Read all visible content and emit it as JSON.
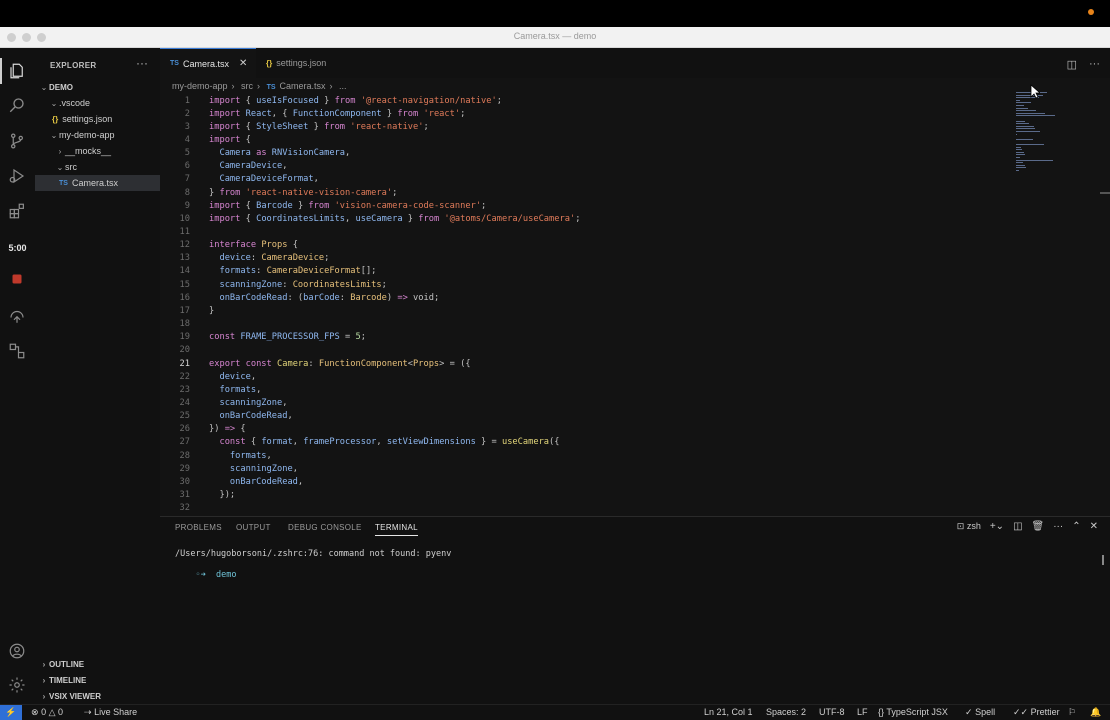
{
  "window": {
    "title": "Camera.tsx — demo"
  },
  "activity_bar": {
    "icons": [
      "files-icon",
      "search-icon",
      "source-control-icon",
      "run-debug-icon",
      "extensions-icon",
      "record-icon",
      "remote-icon",
      "project-manager-icon",
      "account-icon",
      "settings-gear-icon"
    ],
    "timer": "5:00"
  },
  "explorer": {
    "title": "EXPLORER",
    "tree": [
      {
        "label": "DEMO",
        "kind": "root"
      },
      {
        "label": ".vscode",
        "kind": "folder-open"
      },
      {
        "label": "settings.json",
        "kind": "json"
      },
      {
        "label": "my-demo-app",
        "kind": "folder-open"
      },
      {
        "label": "__mocks__",
        "kind": "folder-closed"
      },
      {
        "label": "src",
        "kind": "folder-open"
      },
      {
        "label": "Camera.tsx",
        "kind": "ts",
        "selected": true
      }
    ],
    "sections": [
      "OUTLINE",
      "TIMELINE",
      "VSIX VIEWER"
    ]
  },
  "tabs": [
    {
      "label": "Camera.tsx",
      "icon": "TS",
      "active": true
    },
    {
      "label": "settings.json",
      "icon": "{}",
      "active": false
    }
  ],
  "breadcrumb": [
    "my-demo-app",
    "src",
    "Camera.tsx",
    "..."
  ],
  "code": {
    "current_line": 21,
    "lines": [
      [
        [
          "k",
          "import "
        ],
        [
          "p",
          "{ "
        ],
        [
          "v",
          "useIsFocused"
        ],
        [
          "p",
          " } "
        ],
        [
          "k",
          "from "
        ],
        [
          "s",
          "'@react-navigation/native'"
        ],
        [
          "p",
          ";"
        ]
      ],
      [
        [
          "k",
          "import "
        ],
        [
          "v",
          "React"
        ],
        [
          "p",
          ", { "
        ],
        [
          "v",
          "FunctionComponent"
        ],
        [
          "p",
          " } "
        ],
        [
          "k",
          "from "
        ],
        [
          "s",
          "'react'"
        ],
        [
          "p",
          ";"
        ]
      ],
      [
        [
          "k",
          "import "
        ],
        [
          "p",
          "{ "
        ],
        [
          "v",
          "StyleSheet"
        ],
        [
          "p",
          " } "
        ],
        [
          "k",
          "from "
        ],
        [
          "s",
          "'react-native'"
        ],
        [
          "p",
          ";"
        ]
      ],
      [
        [
          "k",
          "import "
        ],
        [
          "p",
          "{"
        ]
      ],
      [
        [
          "p",
          "  "
        ],
        [
          "v",
          "Camera"
        ],
        [
          "k",
          " as "
        ],
        [
          "v",
          "RNVisionCamera"
        ],
        [
          "p",
          ","
        ]
      ],
      [
        [
          "p",
          "  "
        ],
        [
          "v",
          "CameraDevice"
        ],
        [
          "p",
          ","
        ]
      ],
      [
        [
          "p",
          "  "
        ],
        [
          "v",
          "CameraDeviceFormat"
        ],
        [
          "p",
          ","
        ]
      ],
      [
        [
          "p",
          "} "
        ],
        [
          "k",
          "from "
        ],
        [
          "s",
          "'react-native-vision-camera'"
        ],
        [
          "p",
          ";"
        ]
      ],
      [
        [
          "k",
          "import "
        ],
        [
          "p",
          "{ "
        ],
        [
          "v",
          "Barcode"
        ],
        [
          "p",
          " } "
        ],
        [
          "k",
          "from "
        ],
        [
          "s",
          "'vision-camera-code-scanner'"
        ],
        [
          "p",
          ";"
        ]
      ],
      [
        [
          "k",
          "import "
        ],
        [
          "p",
          "{ "
        ],
        [
          "v",
          "CoordinatesLimits"
        ],
        [
          "p",
          ", "
        ],
        [
          "v",
          "useCamera"
        ],
        [
          "p",
          " } "
        ],
        [
          "k",
          "from "
        ],
        [
          "s",
          "'@atoms/Camera/useCamera'"
        ],
        [
          "p",
          ";"
        ]
      ],
      [],
      [
        [
          "k",
          "interface "
        ],
        [
          "t",
          "Props "
        ],
        [
          "p",
          "{"
        ]
      ],
      [
        [
          "p",
          "  "
        ],
        [
          "v",
          "device"
        ],
        [
          "p",
          ": "
        ],
        [
          "t",
          "CameraDevice"
        ],
        [
          "p",
          ";"
        ]
      ],
      [
        [
          "p",
          "  "
        ],
        [
          "v",
          "formats"
        ],
        [
          "p",
          ": "
        ],
        [
          "t",
          "CameraDeviceFormat"
        ],
        [
          "p",
          "[];"
        ]
      ],
      [
        [
          "p",
          "  "
        ],
        [
          "v",
          "scanningZone"
        ],
        [
          "p",
          ": "
        ],
        [
          "t",
          "CoordinatesLimits"
        ],
        [
          "p",
          ";"
        ]
      ],
      [
        [
          "p",
          "  "
        ],
        [
          "v",
          "onBarCodeRead"
        ],
        [
          "p",
          ": ("
        ],
        [
          "v",
          "barCode"
        ],
        [
          "p",
          ": "
        ],
        [
          "t",
          "Barcode"
        ],
        [
          "p",
          ") "
        ],
        [
          "k",
          "=>"
        ],
        [
          "p",
          " void;"
        ]
      ],
      [
        [
          "p",
          "}"
        ]
      ],
      [],
      [
        [
          "k",
          "const "
        ],
        [
          "v",
          "FRAME_PROCESSOR_FPS"
        ],
        [
          "p",
          " = "
        ],
        [
          "n",
          "5"
        ],
        [
          "p",
          ";"
        ]
      ],
      [],
      [
        [
          "k",
          "export const "
        ],
        [
          "f",
          "Camera"
        ],
        [
          "p",
          ": "
        ],
        [
          "t",
          "FunctionComponent"
        ],
        [
          "p",
          "<"
        ],
        [
          "t",
          "Props"
        ],
        [
          "p",
          "> = ({"
        ]
      ],
      [
        [
          "p",
          "  "
        ],
        [
          "v",
          "device"
        ],
        [
          "p",
          ","
        ]
      ],
      [
        [
          "p",
          "  "
        ],
        [
          "v",
          "formats"
        ],
        [
          "p",
          ","
        ]
      ],
      [
        [
          "p",
          "  "
        ],
        [
          "v",
          "scanningZone"
        ],
        [
          "p",
          ","
        ]
      ],
      [
        [
          "p",
          "  "
        ],
        [
          "v",
          "onBarCodeRead"
        ],
        [
          "p",
          ","
        ]
      ],
      [
        [
          "p",
          "}) "
        ],
        [
          "k",
          "=>"
        ],
        [
          "p",
          " {"
        ]
      ],
      [
        [
          "p",
          "  "
        ],
        [
          "k",
          "const "
        ],
        [
          "p",
          "{ "
        ],
        [
          "v",
          "format"
        ],
        [
          "p",
          ", "
        ],
        [
          "v",
          "frameProcessor"
        ],
        [
          "p",
          ", "
        ],
        [
          "v",
          "setViewDimensions"
        ],
        [
          "p",
          " } = "
        ],
        [
          "f",
          "useCamera"
        ],
        [
          "p",
          "({"
        ]
      ],
      [
        [
          "p",
          "    "
        ],
        [
          "v",
          "formats"
        ],
        [
          "p",
          ","
        ]
      ],
      [
        [
          "p",
          "    "
        ],
        [
          "v",
          "scanningZone"
        ],
        [
          "p",
          ","
        ]
      ],
      [
        [
          "p",
          "    "
        ],
        [
          "v",
          "onBarCodeRead"
        ],
        [
          "p",
          ","
        ]
      ],
      [
        [
          "p",
          "  });"
        ]
      ],
      []
    ]
  },
  "panel": {
    "tabs": [
      "PROBLEMS",
      "OUTPUT",
      "DEBUG CONSOLE",
      "TERMINAL"
    ],
    "active_tab": "TERMINAL",
    "shell": "zsh",
    "terminal_lines": [
      "/Users/hugoborsoni/.zshrc:76: command not found: pyenv"
    ],
    "prompt_dir": "demo"
  },
  "status": {
    "errors": "0",
    "warnings": "0",
    "live_share": "Live Share",
    "position": "Ln 21, Col 1",
    "spaces": "Spaces: 2",
    "encoding": "UTF-8",
    "eol": "LF",
    "language": "TypeScript JSX",
    "spell": "Spell",
    "prettier": "Prettier"
  }
}
